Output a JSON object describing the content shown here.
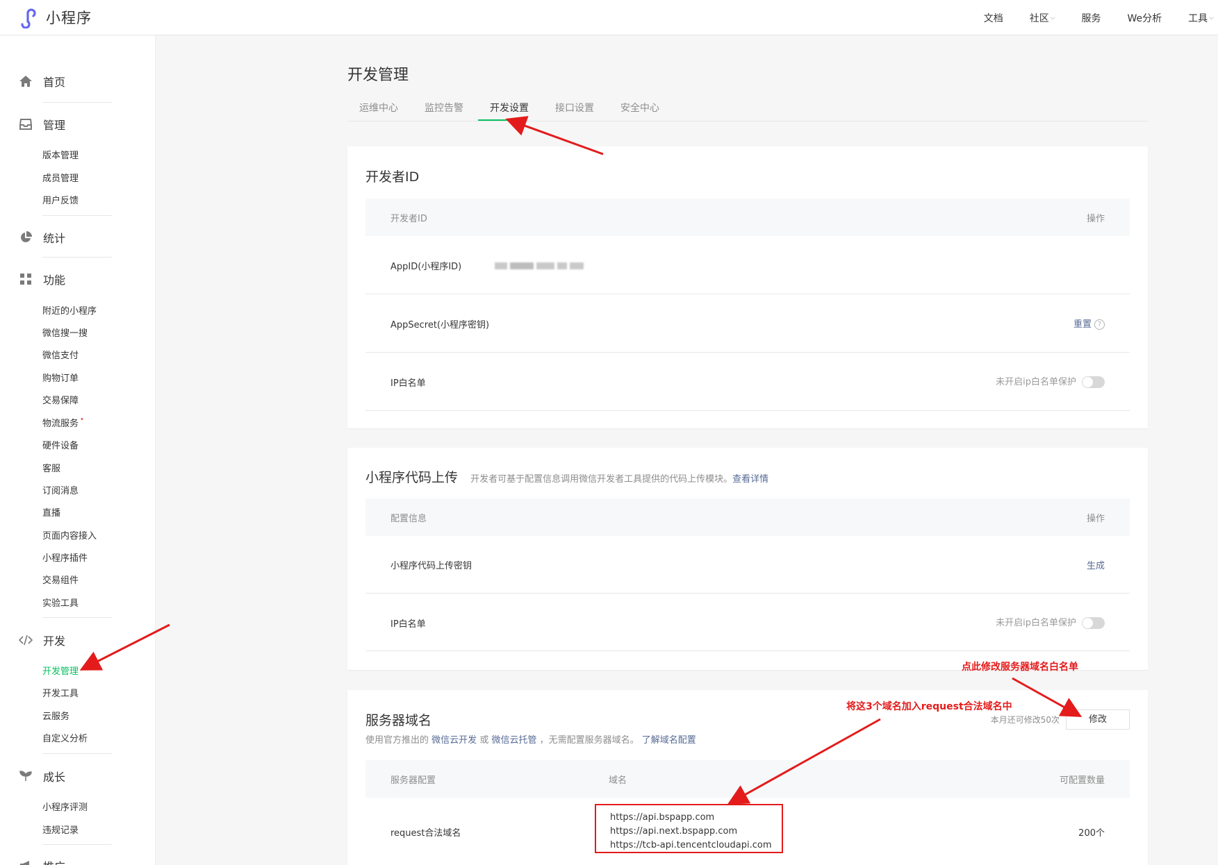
{
  "app": {
    "name": "小程序"
  },
  "topnav": [
    {
      "label": "文档",
      "dropdown": false
    },
    {
      "label": "社区",
      "dropdown": true
    },
    {
      "label": "服务",
      "dropdown": false
    },
    {
      "label": "We分析",
      "dropdown": false
    },
    {
      "label": "工具",
      "dropdown": true
    }
  ],
  "sidebar": {
    "home": "首页",
    "manage": {
      "label": "管理",
      "items": [
        "版本管理",
        "成员管理",
        "用户反馈"
      ]
    },
    "stats": "统计",
    "features": {
      "label": "功能",
      "items": [
        "附近的小程序",
        "微信搜一搜",
        "微信支付",
        "购物订单",
        "交易保障",
        "物流服务",
        "硬件设备",
        "客服",
        "订阅消息",
        "直播",
        "页面内容接入",
        "小程序插件",
        "交易组件",
        "实验工具"
      ]
    },
    "dev": {
      "label": "开发",
      "items": [
        "开发管理",
        "开发工具",
        "云服务",
        "自定义分析"
      ],
      "active": "开发管理"
    },
    "growth": {
      "label": "成长",
      "items": [
        "小程序评测",
        "违规记录"
      ]
    },
    "promo": "推广"
  },
  "page": {
    "title": "开发管理",
    "tabs": [
      "运维中心",
      "监控告警",
      "开发设置",
      "接口设置",
      "安全中心"
    ],
    "active_tab": "开发设置"
  },
  "devid": {
    "title": "开发者ID",
    "col_name": "开发者ID",
    "col_action": "操作",
    "appid_label": "AppID(小程序ID)",
    "secret_label": "AppSecret(小程序密钥)",
    "secret_action": "重置",
    "ip_label": "IP白名单",
    "ip_status": "未开启ip白名单保护"
  },
  "upload": {
    "title": "小程序代码上传",
    "desc": "开发者可基于配置信息调用微信开发者工具提供的代码上传模块。",
    "desc_link": "查看详情",
    "col_config": "配置信息",
    "col_action": "操作",
    "key_label": "小程序代码上传密钥",
    "key_action": "生成",
    "ip_label": "IP白名单",
    "ip_status": "未开启ip白名单保护"
  },
  "server": {
    "title": "服务器域名",
    "desc_prefix": "使用官方推出的",
    "link1": "微信云开发",
    "or": "或",
    "link2": "微信云托管",
    "desc_suffix": "，无需配置服务器域名。",
    "link3": "了解域名配置",
    "remaining": "本月还可修改50次",
    "modify_button": "修改",
    "col_config": "服务器配置",
    "col_domain": "域名",
    "col_count": "可配置数量",
    "request_label": "request合法域名",
    "domains": [
      "https://api.bspapp.com",
      "https://api.next.bspapp.com",
      "https://tcb-api.tencentcloudapi.com"
    ],
    "count": "200个"
  },
  "annotations": {
    "note_modify": "点此修改服务器域名白名单",
    "note_domains": "将这3个域名加入request合法域名中"
  }
}
